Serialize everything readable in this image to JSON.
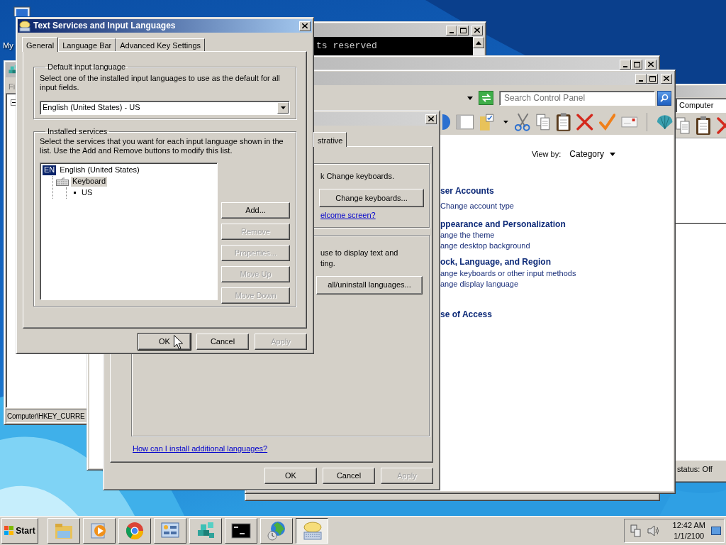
{
  "desktop_icons": [
    {
      "label": "My"
    }
  ],
  "console_window": {
    "text": "ts reserved"
  },
  "computer_window": {
    "address": "Computer",
    "status": "status: Off"
  },
  "control_panel": {
    "search": {
      "placeholder": "Search Control Panel"
    },
    "view_by": {
      "label": "View by:",
      "value": "Category"
    },
    "categories": [
      {
        "title": "ser Accounts",
        "links": [
          "Change account type"
        ]
      },
      {
        "title": "ppearance and Personalization",
        "links": [
          "ange the theme",
          "ange desktop background"
        ]
      },
      {
        "title": "ock, Language, and Region",
        "links": [
          "ange keyboards or other input methods",
          "ange display language"
        ]
      },
      {
        "title": "se of Access"
      }
    ]
  },
  "registry_editor": {
    "menu": "Fi",
    "status_bar": "Computer\\HKEY_CURRE"
  },
  "region_dialog": {
    "tab": "strative",
    "keyboards": {
      "text": "k Change keyboards.",
      "button": "Change keyboards...",
      "link": "elcome screen?"
    },
    "languages": {
      "lines": [
        "use to display text and",
        "ting."
      ],
      "button": "all/uninstall languages..."
    },
    "help_link": "How can I install additional languages?",
    "buttons": [
      {
        "label": "OK",
        "disabled": false,
        "default": false
      },
      {
        "label": "Cancel",
        "disabled": false,
        "default": false
      },
      {
        "label": "Apply",
        "disabled": true,
        "default": false
      }
    ]
  },
  "text_services_dialog": {
    "title": "Text Services and Input Languages",
    "tabs": [
      {
        "label": "General",
        "selected": true
      },
      {
        "label": "Language Bar",
        "selected": false
      },
      {
        "label": "Advanced Key Settings",
        "selected": false
      }
    ],
    "default_language": {
      "legend": "Default input language",
      "description": "Select one of the installed input languages to use as the default for all input fields.",
      "value": "English (United States) - US"
    },
    "installed_services": {
      "legend": "Installed services",
      "description": "Select the services that you want for each input language shown in the list. Use the Add and Remove buttons to modify this list.",
      "tree": [
        {
          "kind": "language",
          "badge": "EN",
          "label": "English (United States)",
          "selected": false,
          "children": [
            {
              "kind": "service",
              "label": "Keyboard",
              "selected": true,
              "children": [
                {
                  "kind": "layout",
                  "label": "US",
                  "selected": false
                }
              ]
            }
          ]
        }
      ],
      "buttons": [
        {
          "label": "Add...",
          "disabled": false
        },
        {
          "label": "Remove",
          "disabled": true
        },
        {
          "label": "Properties...",
          "disabled": true
        },
        {
          "label": "Move Up",
          "disabled": true
        },
        {
          "label": "Move Down",
          "disabled": true
        }
      ]
    },
    "buttons": [
      {
        "label": "OK",
        "disabled": false,
        "default": true
      },
      {
        "label": "Cancel",
        "disabled": false,
        "default": false
      },
      {
        "label": "Apply",
        "disabled": true,
        "default": false
      }
    ]
  },
  "taskbar": {
    "start": "Start",
    "apps": [
      {
        "kind": "folder",
        "active": false
      },
      {
        "kind": "player",
        "active": false
      },
      {
        "kind": "browser",
        "active": false
      },
      {
        "kind": "panel",
        "active": false
      },
      {
        "kind": "cubes",
        "active": false
      },
      {
        "kind": "console",
        "active": false
      },
      {
        "kind": "globe",
        "active": false
      },
      {
        "kind": "keyboard",
        "active": true
      }
    ],
    "time": "12:42 AM",
    "date": "1/1/2100"
  }
}
